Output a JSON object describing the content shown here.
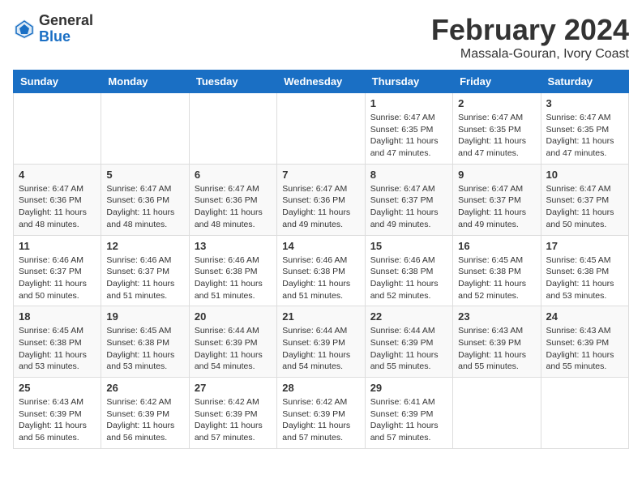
{
  "logo": {
    "general": "General",
    "blue": "Blue"
  },
  "title": {
    "month_year": "February 2024",
    "location": "Massala-Gouran, Ivory Coast"
  },
  "header": {
    "days": [
      "Sunday",
      "Monday",
      "Tuesday",
      "Wednesday",
      "Thursday",
      "Friday",
      "Saturday"
    ]
  },
  "weeks": [
    [
      {
        "day": "",
        "info": ""
      },
      {
        "day": "",
        "info": ""
      },
      {
        "day": "",
        "info": ""
      },
      {
        "day": "",
        "info": ""
      },
      {
        "day": "1",
        "info": "Sunrise: 6:47 AM\nSunset: 6:35 PM\nDaylight: 11 hours\nand 47 minutes."
      },
      {
        "day": "2",
        "info": "Sunrise: 6:47 AM\nSunset: 6:35 PM\nDaylight: 11 hours\nand 47 minutes."
      },
      {
        "day": "3",
        "info": "Sunrise: 6:47 AM\nSunset: 6:35 PM\nDaylight: 11 hours\nand 47 minutes."
      }
    ],
    [
      {
        "day": "4",
        "info": "Sunrise: 6:47 AM\nSunset: 6:36 PM\nDaylight: 11 hours\nand 48 minutes."
      },
      {
        "day": "5",
        "info": "Sunrise: 6:47 AM\nSunset: 6:36 PM\nDaylight: 11 hours\nand 48 minutes."
      },
      {
        "day": "6",
        "info": "Sunrise: 6:47 AM\nSunset: 6:36 PM\nDaylight: 11 hours\nand 48 minutes."
      },
      {
        "day": "7",
        "info": "Sunrise: 6:47 AM\nSunset: 6:36 PM\nDaylight: 11 hours\nand 49 minutes."
      },
      {
        "day": "8",
        "info": "Sunrise: 6:47 AM\nSunset: 6:37 PM\nDaylight: 11 hours\nand 49 minutes."
      },
      {
        "day": "9",
        "info": "Sunrise: 6:47 AM\nSunset: 6:37 PM\nDaylight: 11 hours\nand 49 minutes."
      },
      {
        "day": "10",
        "info": "Sunrise: 6:47 AM\nSunset: 6:37 PM\nDaylight: 11 hours\nand 50 minutes."
      }
    ],
    [
      {
        "day": "11",
        "info": "Sunrise: 6:46 AM\nSunset: 6:37 PM\nDaylight: 11 hours\nand 50 minutes."
      },
      {
        "day": "12",
        "info": "Sunrise: 6:46 AM\nSunset: 6:37 PM\nDaylight: 11 hours\nand 51 minutes."
      },
      {
        "day": "13",
        "info": "Sunrise: 6:46 AM\nSunset: 6:38 PM\nDaylight: 11 hours\nand 51 minutes."
      },
      {
        "day": "14",
        "info": "Sunrise: 6:46 AM\nSunset: 6:38 PM\nDaylight: 11 hours\nand 51 minutes."
      },
      {
        "day": "15",
        "info": "Sunrise: 6:46 AM\nSunset: 6:38 PM\nDaylight: 11 hours\nand 52 minutes."
      },
      {
        "day": "16",
        "info": "Sunrise: 6:45 AM\nSunset: 6:38 PM\nDaylight: 11 hours\nand 52 minutes."
      },
      {
        "day": "17",
        "info": "Sunrise: 6:45 AM\nSunset: 6:38 PM\nDaylight: 11 hours\nand 53 minutes."
      }
    ],
    [
      {
        "day": "18",
        "info": "Sunrise: 6:45 AM\nSunset: 6:38 PM\nDaylight: 11 hours\nand 53 minutes."
      },
      {
        "day": "19",
        "info": "Sunrise: 6:45 AM\nSunset: 6:38 PM\nDaylight: 11 hours\nand 53 minutes."
      },
      {
        "day": "20",
        "info": "Sunrise: 6:44 AM\nSunset: 6:39 PM\nDaylight: 11 hours\nand 54 minutes."
      },
      {
        "day": "21",
        "info": "Sunrise: 6:44 AM\nSunset: 6:39 PM\nDaylight: 11 hours\nand 54 minutes."
      },
      {
        "day": "22",
        "info": "Sunrise: 6:44 AM\nSunset: 6:39 PM\nDaylight: 11 hours\nand 55 minutes."
      },
      {
        "day": "23",
        "info": "Sunrise: 6:43 AM\nSunset: 6:39 PM\nDaylight: 11 hours\nand 55 minutes."
      },
      {
        "day": "24",
        "info": "Sunrise: 6:43 AM\nSunset: 6:39 PM\nDaylight: 11 hours\nand 55 minutes."
      }
    ],
    [
      {
        "day": "25",
        "info": "Sunrise: 6:43 AM\nSunset: 6:39 PM\nDaylight: 11 hours\nand 56 minutes."
      },
      {
        "day": "26",
        "info": "Sunrise: 6:42 AM\nSunset: 6:39 PM\nDaylight: 11 hours\nand 56 minutes."
      },
      {
        "day": "27",
        "info": "Sunrise: 6:42 AM\nSunset: 6:39 PM\nDaylight: 11 hours\nand 57 minutes."
      },
      {
        "day": "28",
        "info": "Sunrise: 6:42 AM\nSunset: 6:39 PM\nDaylight: 11 hours\nand 57 minutes."
      },
      {
        "day": "29",
        "info": "Sunrise: 6:41 AM\nSunset: 6:39 PM\nDaylight: 11 hours\nand 57 minutes."
      },
      {
        "day": "",
        "info": ""
      },
      {
        "day": "",
        "info": ""
      }
    ]
  ]
}
